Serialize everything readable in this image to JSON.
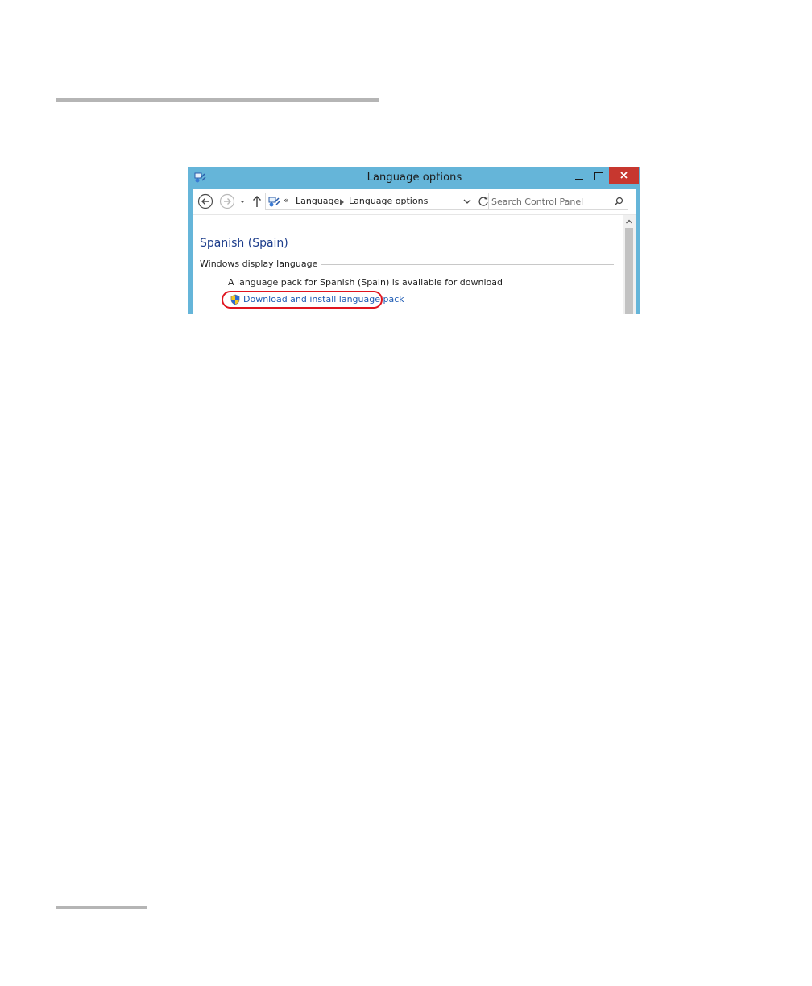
{
  "window": {
    "title": "Language options",
    "accent_color": "#65b5d9",
    "close_color": "#c7372f"
  },
  "navigation": {
    "breadcrumb": {
      "overflow": "«",
      "items": [
        "Language",
        "Language options"
      ]
    },
    "search": {
      "placeholder": "Search Control Panel"
    }
  },
  "content": {
    "heading": "Spanish (Spain)",
    "section_label": "Windows display language",
    "availability_text": "A language pack for Spanish (Spain) is available for download",
    "download_link": "Download and install language pack",
    "link_color": "#1f5cb4",
    "highlight_color": "#e0151f"
  },
  "icons": {
    "app": "control-panel-icon",
    "back": "back-arrow-icon",
    "forward": "forward-arrow-icon",
    "recent": "chevron-down-icon",
    "up": "up-arrow-icon",
    "address": "control-panel-icon",
    "refresh": "refresh-icon",
    "search": "search-icon",
    "link": "shield-icon"
  }
}
